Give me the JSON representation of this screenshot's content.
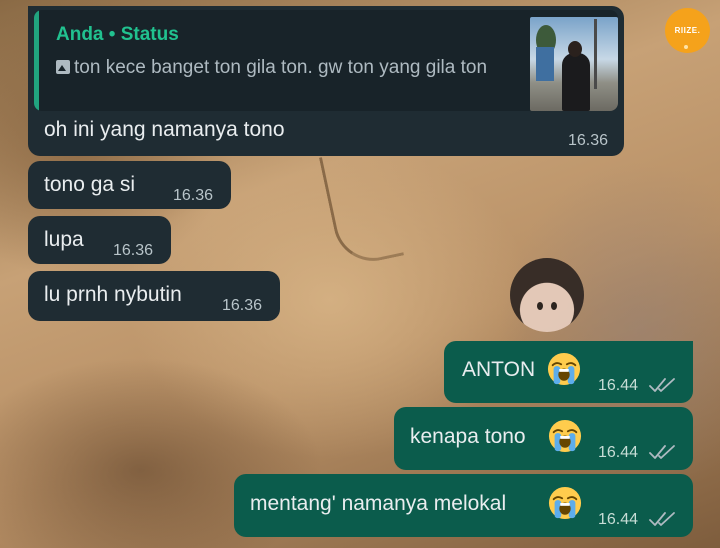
{
  "chat": {
    "overlay_logo_text": "RIIZE.",
    "messages": [
      {
        "direction": "incoming",
        "reply_to": {
          "author": "Anda • Status",
          "text": "ton kece banget ton gila ton. gw ton yang gila ton",
          "media_icon": "image-icon"
        },
        "text": "oh ini yang namanya tono",
        "time": "16.36"
      },
      {
        "direction": "incoming",
        "text": "tono ga si",
        "time": "16.36"
      },
      {
        "direction": "incoming",
        "text": "lupa",
        "time": "16.36"
      },
      {
        "direction": "incoming",
        "text": "lu prnh nybutin",
        "time": "16.36"
      },
      {
        "direction": "outgoing",
        "text": "ANTON",
        "emoji": "loudly-crying-face",
        "time": "16.44",
        "status": "read"
      },
      {
        "direction": "outgoing",
        "text": "kenapa tono",
        "emoji": "loudly-crying-face",
        "time": "16.44",
        "status": "read"
      },
      {
        "direction": "outgoing",
        "text": "mentang' namanya melokal",
        "emoji": "loudly-crying-face",
        "time": "16.44",
        "status": "read"
      }
    ]
  },
  "colors": {
    "incoming_bubble": "#1f2c33",
    "outgoing_bubble": "#0b5c4c",
    "quote_accent": "#21a47f",
    "read_ticks": "#aebac1"
  }
}
